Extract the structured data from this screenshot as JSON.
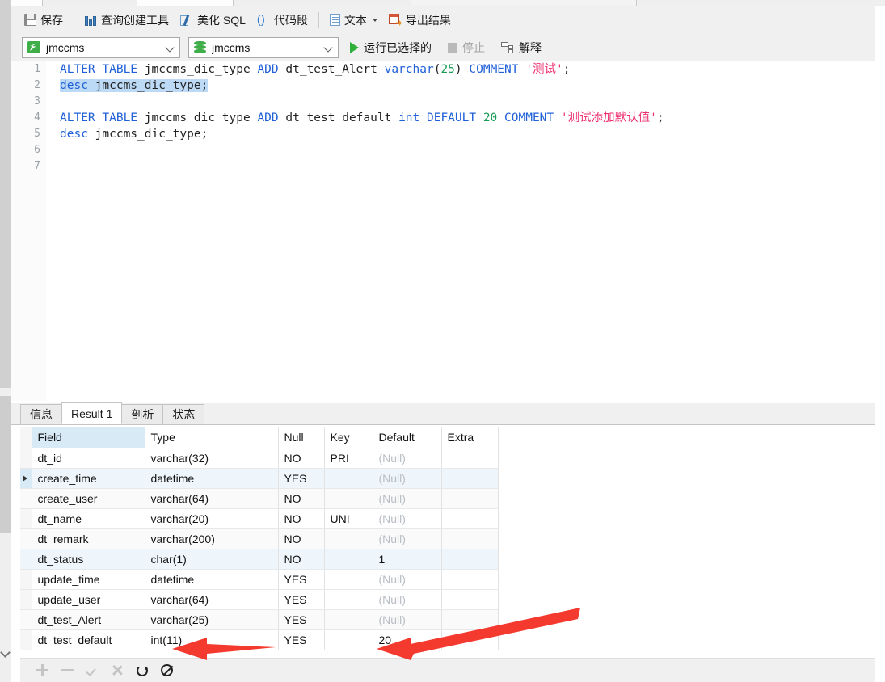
{
  "toolbar": {
    "buttons": [
      {
        "id": "save",
        "label": "保存",
        "icon": "save-icon"
      },
      {
        "id": "query-builder",
        "label": "查询创建工具",
        "icon": "query-builder-icon"
      },
      {
        "id": "beautify-sql",
        "label": "美化 SQL",
        "icon": "beautify-icon"
      },
      {
        "id": "code-snippet",
        "label": "代码段",
        "icon": "snippet-icon"
      },
      {
        "id": "text",
        "label": "文本",
        "icon": "text-icon",
        "has_caret": true
      },
      {
        "id": "export-result",
        "label": "导出结果",
        "icon": "export-icon"
      }
    ],
    "connection_select": {
      "value": "jmccms",
      "icon": "mysql-dolphin-icon"
    },
    "database_select": {
      "value": "jmccms",
      "icon": "database-icon"
    },
    "run_selected": {
      "label": "运行已选择的",
      "icon": "play-icon"
    },
    "stop": {
      "label": "停止",
      "icon": "stop-icon",
      "disabled": true
    },
    "explain": {
      "label": "解释",
      "icon": "explain-icon"
    }
  },
  "editor": {
    "line_numbers": [
      "1",
      "2",
      "3",
      "4",
      "5",
      "6",
      "7"
    ],
    "lines": [
      {
        "n": 1,
        "tokens": [
          {
            "t": "ALTER TABLE ",
            "c": "kw"
          },
          {
            "t": "jmccms_dic_type ",
            "c": "pl"
          },
          {
            "t": "ADD ",
            "c": "kw"
          },
          {
            "t": "dt_test_Alert ",
            "c": "pl"
          },
          {
            "t": "varchar",
            "c": "kw"
          },
          {
            "t": "(",
            "c": "pl"
          },
          {
            "t": "25",
            "c": "num"
          },
          {
            "t": ") ",
            "c": "pl"
          },
          {
            "t": "COMMENT ",
            "c": "kw"
          },
          {
            "t": "'测试'",
            "c": "str"
          },
          {
            "t": ";",
            "c": "pl"
          }
        ]
      },
      {
        "n": 2,
        "selected": true,
        "tokens": [
          {
            "t": "desc ",
            "c": "kw"
          },
          {
            "t": "jmccms_dic_type;",
            "c": "pl"
          }
        ]
      },
      {
        "n": 3,
        "tokens": []
      },
      {
        "n": 4,
        "tokens": [
          {
            "t": "ALTER TABLE ",
            "c": "kw"
          },
          {
            "t": "jmccms_dic_type ",
            "c": "pl"
          },
          {
            "t": "ADD ",
            "c": "kw"
          },
          {
            "t": "dt_test_default ",
            "c": "pl"
          },
          {
            "t": "int ",
            "c": "kw"
          },
          {
            "t": "DEFAULT ",
            "c": "kw"
          },
          {
            "t": "20 ",
            "c": "num"
          },
          {
            "t": "COMMENT ",
            "c": "kw"
          },
          {
            "t": "'测试添加默认值'",
            "c": "str"
          },
          {
            "t": ";",
            "c": "pl"
          }
        ]
      },
      {
        "n": 5,
        "tokens": [
          {
            "t": "desc ",
            "c": "kw"
          },
          {
            "t": "jmccms_dic_type;",
            "c": "pl"
          }
        ]
      },
      {
        "n": 6,
        "tokens": []
      },
      {
        "n": 7,
        "tokens": []
      }
    ]
  },
  "results": {
    "tabs": [
      {
        "id": "info",
        "label": "信息",
        "active": false
      },
      {
        "id": "result-1",
        "label": "Result 1",
        "active": true
      },
      {
        "id": "profile",
        "label": "剖析",
        "active": false
      },
      {
        "id": "status",
        "label": "状态",
        "active": false
      }
    ],
    "columns": [
      "Field",
      "Type",
      "Null",
      "Key",
      "Default",
      "Extra"
    ],
    "rows": [
      {
        "field": "dt_id",
        "type": "varchar(32)",
        "null": "NO",
        "key": "PRI",
        "default": "(Null)",
        "extra": ""
      },
      {
        "field": "create_time",
        "type": "datetime",
        "null": "YES",
        "key": "",
        "default": "(Null)",
        "extra": "",
        "current": true
      },
      {
        "field": "create_user",
        "type": "varchar(64)",
        "null": "NO",
        "key": "",
        "default": "(Null)",
        "extra": ""
      },
      {
        "field": "dt_name",
        "type": "varchar(20)",
        "null": "NO",
        "key": "UNI",
        "default": "(Null)",
        "extra": ""
      },
      {
        "field": "dt_remark",
        "type": "varchar(200)",
        "null": "NO",
        "key": "",
        "default": "(Null)",
        "extra": ""
      },
      {
        "field": "dt_status",
        "type": "char(1)",
        "null": "NO",
        "key": "",
        "default": "1",
        "extra": ""
      },
      {
        "field": "update_time",
        "type": "datetime",
        "null": "YES",
        "key": "",
        "default": "(Null)",
        "extra": ""
      },
      {
        "field": "update_user",
        "type": "varchar(64)",
        "null": "YES",
        "key": "",
        "default": "(Null)",
        "extra": ""
      },
      {
        "field": "dt_test_Alert",
        "type": "varchar(25)",
        "null": "YES",
        "key": "",
        "default": "(Null)",
        "extra": ""
      },
      {
        "field": "dt_test_default",
        "type": "int(11)",
        "null": "YES",
        "key": "",
        "default": "20",
        "extra": ""
      }
    ],
    "footer_buttons": [
      {
        "id": "add-row",
        "icon": "plus-icon",
        "disabled": true
      },
      {
        "id": "delete-row",
        "icon": "minus-icon",
        "disabled": true
      },
      {
        "id": "apply-change",
        "icon": "check-icon",
        "disabled": true
      },
      {
        "id": "cancel-change",
        "icon": "cross-icon",
        "disabled": true
      },
      {
        "id": "refresh",
        "icon": "refresh-icon",
        "disabled": false
      },
      {
        "id": "stop-load",
        "icon": "ban-icon",
        "disabled": false
      }
    ]
  },
  "annotations": {
    "arrow_color": "#f4392f",
    "arrows": [
      {
        "id": "arrow-type-int11",
        "points_at": "int(11)"
      },
      {
        "id": "arrow-default-20",
        "points_at": "20"
      }
    ]
  }
}
